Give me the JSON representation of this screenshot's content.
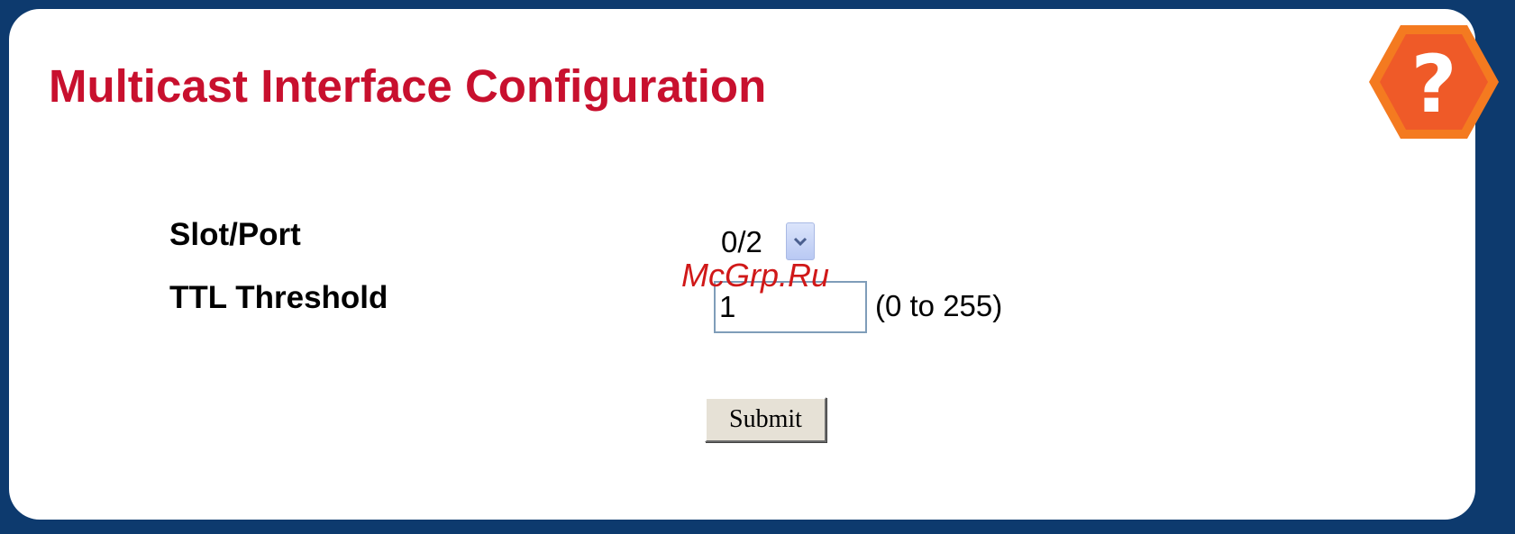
{
  "page": {
    "title": "Multicast Interface Configuration"
  },
  "help": {
    "icon": "help-icon",
    "glyph": "?",
    "colors": {
      "outer": "#f47a20",
      "inner": "#ef5a28"
    }
  },
  "form": {
    "slot_port": {
      "label": "Slot/Port",
      "selected": "0/2"
    },
    "ttl_threshold": {
      "label": "TTL Threshold",
      "value": "1",
      "range_hint": "(0 to 255)"
    },
    "submit_label": "Submit"
  },
  "watermark": "McGrp.Ru",
  "colors": {
    "frame": "#0d3a6e",
    "title": "#c8102e"
  }
}
